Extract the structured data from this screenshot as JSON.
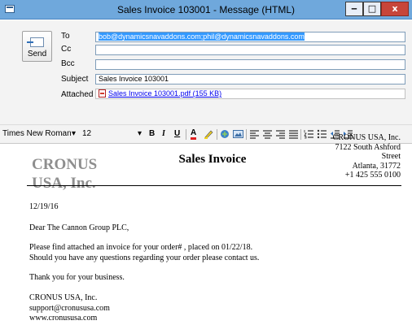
{
  "window": {
    "title": "Sales Invoice 103001 - Message (HTML)",
    "min_glyph": "‒",
    "max_glyph": "□",
    "close_glyph": "x"
  },
  "compose": {
    "send_label": "Send",
    "to_label": "To",
    "to_value": "bob@dynamicsnavaddons.com;phil@dynamicsnavaddons.com",
    "cc_label": "Cc",
    "cc_value": "",
    "bcc_label": "Bcc",
    "bcc_value": "",
    "subject_label": "Subject",
    "subject_value": "Sales Invoice 103001",
    "attached_label": "Attached",
    "attachment_name": "Sales Invoice 103001.pdf (155 KB)"
  },
  "toolbar": {
    "font_name": "Times New Roman",
    "font_size": "12",
    "dropdown_glyph": "▾",
    "bold": "B",
    "italic": "I",
    "underline": "U",
    "font_color": "A"
  },
  "document": {
    "logo_line1": "CRONUS",
    "logo_line2": "USA, Inc.",
    "title": "Sales Invoice",
    "address": [
      "CRONUS USA, Inc.",
      "7122 South Ashford",
      "Street",
      "Atlanta,  31772",
      "+1 425 555 0100"
    ],
    "date": "12/19/16",
    "greeting": "Dear The Cannon Group PLC,",
    "para1_line1": "Please find attached an invoice for your order# , placed on 01/22/18.",
    "para1_line2": "Should you have any questions regarding your order please contact us.",
    "thanks": "Thank you for your business.",
    "sig_company": "CRONUS USA, Inc.",
    "sig_email": "support@cronususa.com",
    "sig_web": "www.cronususa.com"
  },
  "colors": {
    "titlebar": "#6fa8dc",
    "close_button": "#c7453a",
    "selection": "#3399ff",
    "logo_gray": "#8e8e8e"
  }
}
